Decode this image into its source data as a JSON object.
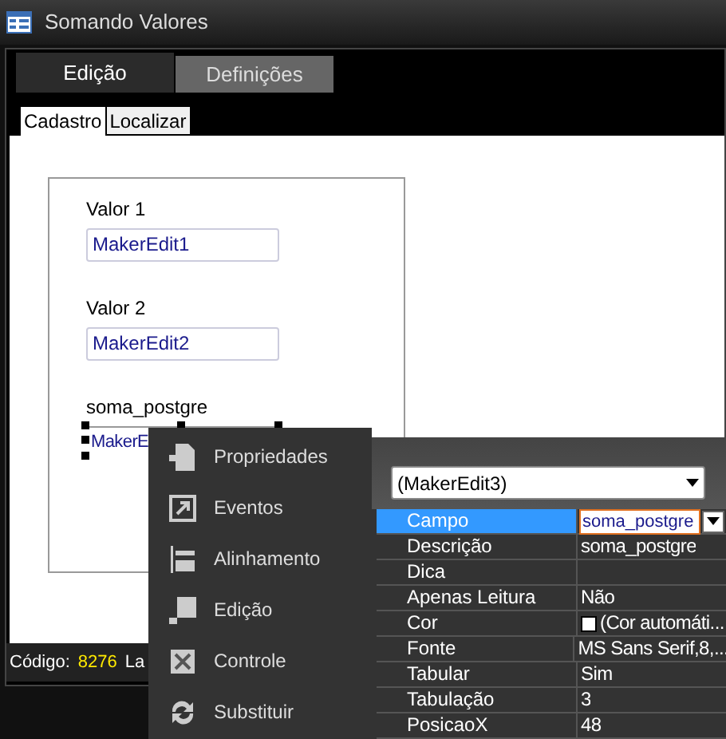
{
  "window": {
    "title": "Somando Valores"
  },
  "tabs": [
    {
      "label": "Edição",
      "selected": true
    },
    {
      "label": "Definições",
      "selected": false
    }
  ],
  "subtabs": [
    {
      "label": "Cadastro",
      "selected": true
    },
    {
      "label": "Localizar",
      "selected": false
    }
  ],
  "form": {
    "fields": [
      {
        "label": "Valor 1",
        "value": "MakerEdit1",
        "selected": false
      },
      {
        "label": "Valor 2",
        "value": "MakerEdit2",
        "selected": false
      },
      {
        "label": "soma_postgre",
        "value": "MakerE",
        "selected": true
      }
    ]
  },
  "status_bar": {
    "label": "Código:",
    "value": "8276",
    "next_label": "La"
  },
  "context_menu": {
    "items": [
      {
        "label": "Propriedades"
      },
      {
        "label": "Eventos"
      },
      {
        "label": "Alinhamento"
      },
      {
        "label": "Edição"
      },
      {
        "label": "Controle"
      },
      {
        "label": "Substituir"
      }
    ]
  },
  "properties": {
    "object": "(MakerEdit3)",
    "rows": [
      {
        "name": "Campo",
        "value": "soma_postgre",
        "selected": true,
        "kind": "dropdown"
      },
      {
        "name": "Descrição",
        "value": "soma_postgre",
        "selected": false,
        "kind": "text"
      },
      {
        "name": "Dica",
        "selected": false,
        "kind": "text"
      },
      {
        "name": "Apenas Leitura",
        "value": "Não",
        "selected": false,
        "kind": "text"
      },
      {
        "name": "Cor",
        "value": "(Cor automáti...",
        "selected": false,
        "kind": "color"
      },
      {
        "name": "Fonte",
        "value": "MS Sans Serif,8,...",
        "selected": false,
        "kind": "text"
      },
      {
        "name": "Tabular",
        "value": "Sim",
        "selected": false,
        "kind": "text"
      },
      {
        "name": "Tabulação",
        "value": "3",
        "selected": false,
        "kind": "text"
      },
      {
        "name": "PosicaoX",
        "value": "48",
        "selected": false,
        "kind": "text"
      }
    ]
  }
}
